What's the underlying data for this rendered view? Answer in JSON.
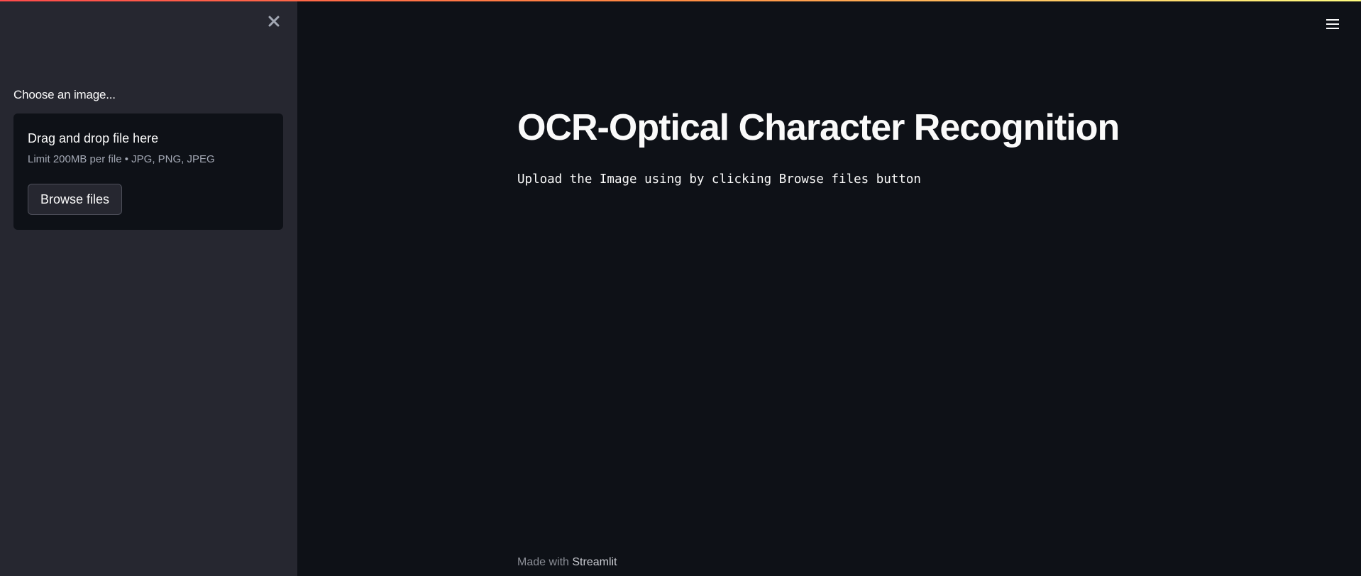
{
  "sidebar": {
    "close_icon": "close-icon",
    "uploader": {
      "label": "Choose an image...",
      "drop_text": "Drag and drop file here",
      "limit_text": "Limit 200MB per file • JPG, PNG, JPEG",
      "browse_label": "Browse files"
    }
  },
  "header": {
    "menu_icon": "hamburger-menu-icon",
    "accent_gradient": [
      "#ff4b4b",
      "#ff8c42",
      "#fffd80"
    ]
  },
  "main": {
    "title": "OCR-Optical Character Recognition",
    "description": "Upload the Image using by clicking Browse files button"
  },
  "footer": {
    "made_with": "Made with",
    "brand": "Streamlit"
  },
  "colors": {
    "main_bg": "#0e1117",
    "sidebar_bg": "#262730",
    "text": "#fafafa",
    "muted_text": "#a3a8b4"
  }
}
